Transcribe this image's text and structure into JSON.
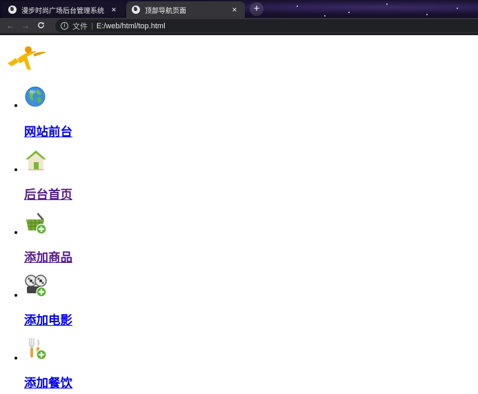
{
  "browser": {
    "tabs": [
      {
        "title": "漫步时尚广场后台管理系统",
        "close_glyph": "×",
        "icon": "globe-icon"
      },
      {
        "title": "顶部导航页面",
        "close_glyph": "×",
        "icon": "globe-icon"
      }
    ],
    "new_tab_glyph": "+",
    "nav": {
      "back_glyph": "←",
      "forward_glyph": "→",
      "reload_glyph": "C"
    },
    "address": {
      "scheme_label": "文件",
      "separator": "|",
      "url": "E:/web/html/top.html",
      "info_glyph": "i"
    }
  },
  "page": {
    "logo": {
      "icon": "running-figure-logo-icon",
      "colors": [
        "#f5b800",
        "#e89a00"
      ]
    },
    "menu": [
      {
        "label": "网站前台",
        "icon": "globe-icon",
        "visited": false
      },
      {
        "label": "后台首页",
        "icon": "home-icon",
        "visited": true
      },
      {
        "label": "添加商品",
        "icon": "shopping-basket-add-icon",
        "visited": true
      },
      {
        "label": "添加电影",
        "icon": "film-reel-add-icon",
        "visited": false
      },
      {
        "label": "添加餐饮",
        "icon": "cutlery-add-icon",
        "visited": false
      }
    ]
  },
  "colors": {
    "link_unvisited": "#0000ee",
    "link_visited": "#551a8b",
    "tab_active": "#353539",
    "toolbar": "#353539"
  }
}
